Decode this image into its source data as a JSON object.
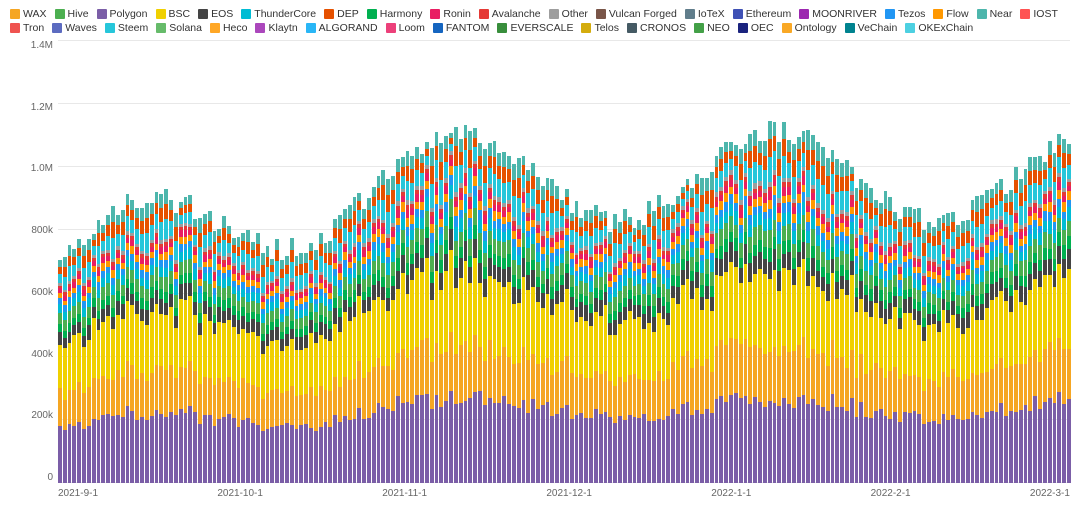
{
  "legend": {
    "items": [
      {
        "label": "WAX",
        "color": "#f5a623"
      },
      {
        "label": "Hive",
        "color": "#4caf50"
      },
      {
        "label": "Polygon",
        "color": "#7b5ea7"
      },
      {
        "label": "BSC",
        "color": "#f0d000"
      },
      {
        "label": "EOS",
        "color": "#444444"
      },
      {
        "label": "ThunderCore",
        "color": "#00bcd4"
      },
      {
        "label": "DEP",
        "color": "#e65100"
      },
      {
        "label": "Harmony",
        "color": "#00b050"
      },
      {
        "label": "Ronin",
        "color": "#e91e63"
      },
      {
        "label": "Avalanche",
        "color": "#e53935"
      },
      {
        "label": "Other",
        "color": "#9e9e9e"
      },
      {
        "label": "Vulcan Forged",
        "color": "#795548"
      },
      {
        "label": "IoTeX",
        "color": "#607d8b"
      },
      {
        "label": "Ethereum",
        "color": "#3f51b5"
      },
      {
        "label": "MOONRIVER",
        "color": "#9c27b0"
      },
      {
        "label": "Tezos",
        "color": "#2196f3"
      },
      {
        "label": "Flow",
        "color": "#ff9800"
      },
      {
        "label": "Near",
        "color": "#4db6ac"
      },
      {
        "label": "IOST",
        "color": "#ff5252"
      },
      {
        "label": "Tron",
        "color": "#ef5350"
      },
      {
        "label": "Waves",
        "color": "#5c6bc0"
      },
      {
        "label": "Steem",
        "color": "#26c6da"
      },
      {
        "label": "Solana",
        "color": "#66bb6a"
      },
      {
        "label": "Heco",
        "color": "#ffa726"
      },
      {
        "label": "Klaytn",
        "color": "#ab47bc"
      },
      {
        "label": "ALGORAND",
        "color": "#29b6f6"
      },
      {
        "label": "Loom",
        "color": "#ec407a"
      },
      {
        "label": "FANTOM",
        "color": "#1565c0"
      },
      {
        "label": "EVERSCALE",
        "color": "#388e3c"
      },
      {
        "label": "Telos",
        "color": "#d4ac0d"
      },
      {
        "label": "CRONOS",
        "color": "#455a64"
      },
      {
        "label": "NEO",
        "color": "#43a047"
      },
      {
        "label": "OEC",
        "color": "#1a237e"
      },
      {
        "label": "Ontology",
        "color": "#f9a825"
      },
      {
        "label": "VeChain",
        "color": "#00838f"
      },
      {
        "label": "OKExChain",
        "color": "#4dd0e1"
      }
    ]
  },
  "yAxis": {
    "labels": [
      "1.4M",
      "1.2M",
      "1.0M",
      "800k",
      "600k",
      "400k",
      "200k",
      "0"
    ]
  },
  "xAxis": {
    "labels": [
      "2021-9-1",
      "2021-10-1",
      "2021-11-1",
      "2021-12-1",
      "2022-1-1",
      "2022-2-1",
      "2022-3-1"
    ]
  }
}
